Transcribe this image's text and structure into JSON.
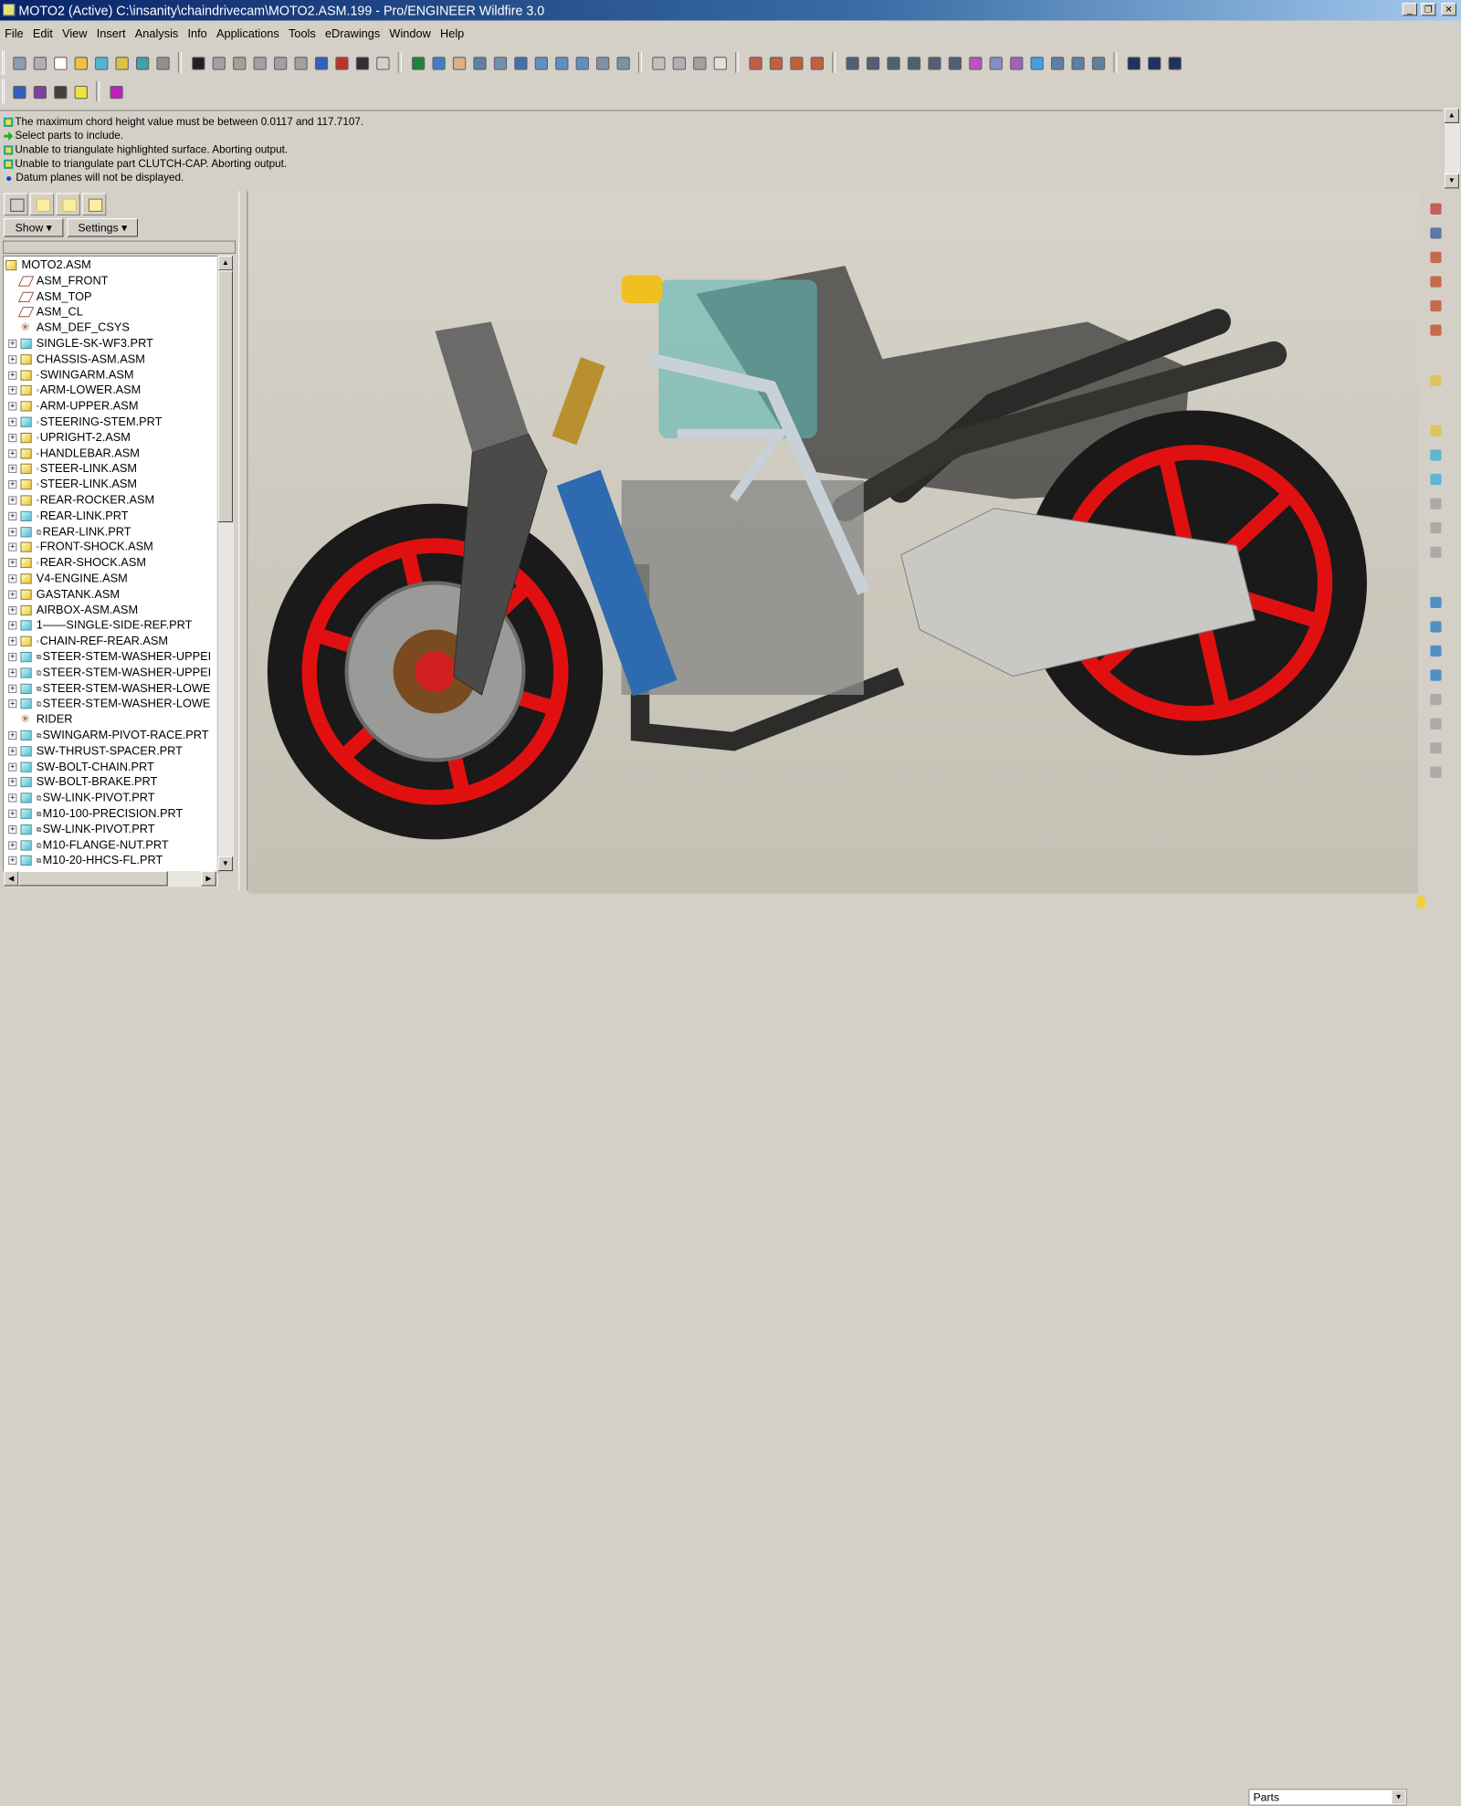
{
  "window": {
    "title": "MOTO2 (Active) C:\\insanity\\chaindrivecam\\MOTO2.ASM.199 - Pro/ENGINEER Wildfire 3.0",
    "controls": [
      "_",
      "❐",
      "✕"
    ]
  },
  "menu": [
    "File",
    "Edit",
    "View",
    "Insert",
    "Analysis",
    "Info",
    "Applications",
    "Tools",
    "eDrawings",
    "Window",
    "Help"
  ],
  "toolbar1": [
    {
      "icon": "new-session-icon",
      "color": "#8aa0b0"
    },
    {
      "icon": "erase-icon",
      "color": "#b0b0b0"
    },
    {
      "icon": "new-file-icon",
      "color": "#ffffff"
    },
    {
      "icon": "open-folder-icon",
      "color": "#f0c040"
    },
    {
      "icon": "save-icon",
      "color": "#50b8d0"
    },
    {
      "icon": "save-copy-icon",
      "color": "#e0c040"
    },
    {
      "icon": "backup-icon",
      "color": "#40a0b0"
    },
    {
      "icon": "print-icon",
      "color": "#909090"
    },
    {
      "sep": true
    },
    {
      "icon": "undo-icon",
      "color": "#202020"
    },
    {
      "icon": "redo-icon",
      "color": "#a0a0a0"
    },
    {
      "icon": "cut-icon",
      "color": "#a0a0a0"
    },
    {
      "icon": "copy-icon",
      "color": "#a0a0a0"
    },
    {
      "icon": "paste-icon",
      "color": "#a0a0a0"
    },
    {
      "icon": "paste-special-icon",
      "color": "#a0a0a0"
    },
    {
      "icon": "regenerate-icon",
      "color": "#3060c0"
    },
    {
      "icon": "regen-manager-icon",
      "color": "#c03030"
    },
    {
      "icon": "find-icon",
      "color": "#303030"
    },
    {
      "icon": "selection-box-icon",
      "color": "#d0d0d0"
    },
    {
      "sep": true
    },
    {
      "icon": "spin-center-icon",
      "color": "#208040"
    },
    {
      "icon": "orient-mode-icon",
      "color": "#4080c0"
    },
    {
      "icon": "pan-icon",
      "color": "#e0b080"
    },
    {
      "icon": "layers-icon",
      "color": "#6080a0"
    },
    {
      "icon": "view-manager-icon",
      "color": "#7090b0"
    },
    {
      "icon": "repaint-icon",
      "color": "#4070b0"
    },
    {
      "icon": "zoom-in-icon",
      "color": "#6090c0"
    },
    {
      "icon": "zoom-out-icon",
      "color": "#6090c0"
    },
    {
      "icon": "refit-icon",
      "color": "#6090c0"
    },
    {
      "icon": "reorient-icon",
      "color": "#8090a0"
    },
    {
      "icon": "saved-views-icon",
      "color": "#8090a0"
    },
    {
      "sep": true
    },
    {
      "icon": "wireframe-icon",
      "color": "#c0c0c0"
    },
    {
      "icon": "hidden-line-icon",
      "color": "#b0b0b0"
    },
    {
      "icon": "no-hidden-icon",
      "color": "#a0a0a0"
    },
    {
      "icon": "shading-icon",
      "color": "#e0e0e0"
    },
    {
      "sep": true
    },
    {
      "icon": "datum-planes-icon",
      "color": "#c06040"
    },
    {
      "icon": "datum-axes-icon",
      "color": "#c06040"
    },
    {
      "icon": "datum-points-icon",
      "color": "#c06040"
    },
    {
      "icon": "coordinate-systems-icon",
      "color": "#c06040"
    },
    {
      "sep": true
    },
    {
      "icon": "measure-icon",
      "color": "#506070"
    },
    {
      "icon": "mass-props-icon",
      "color": "#506070"
    },
    {
      "icon": "section-icon",
      "color": "#506070"
    },
    {
      "icon": "table-icon",
      "color": "#506070"
    },
    {
      "icon": "global-interference-icon",
      "color": "#506070"
    },
    {
      "icon": "pairs-clearance-icon",
      "color": "#506070"
    },
    {
      "icon": "curvature-icon",
      "color": "#c050c0"
    },
    {
      "icon": "draft-icon",
      "color": "#8090c0"
    },
    {
      "icon": "reflection-icon",
      "color": "#a060c0"
    },
    {
      "icon": "shaded-curvature-icon",
      "color": "#40a0e0"
    },
    {
      "icon": "dihedral-icon",
      "color": "#6080a0"
    },
    {
      "icon": "offset-icon",
      "color": "#6080a0"
    },
    {
      "icon": "deviation-icon",
      "color": "#6080a0"
    },
    {
      "sep": true
    },
    {
      "icon": "close-window-icon",
      "color": "#203060"
    },
    {
      "icon": "activate-window-icon",
      "color": "#203060"
    },
    {
      "icon": "close-icon",
      "color": "#203060"
    }
  ],
  "toolbar2": [
    {
      "icon": "model-display-icon",
      "color": "#3060c0"
    },
    {
      "icon": "dimension-display-icon",
      "color": "#8040a0"
    },
    {
      "icon": "component-display-icon",
      "color": "#404040"
    },
    {
      "icon": "component-placement-icon",
      "color": "#f0e040"
    },
    {
      "sep": true
    },
    {
      "icon": "context-help-icon",
      "color": "#c020c0"
    }
  ],
  "messages": [
    {
      "icon": "info",
      "text": "The maximum chord height value must be between 0.0117 and 117.7107."
    },
    {
      "icon": "prompt",
      "text": "Select parts to include."
    },
    {
      "icon": "info",
      "text": "Unable to triangulate highlighted surface. Aborting output."
    },
    {
      "icon": "info",
      "text": "Unable to triangulate part CLUTCH-CAP.  Aborting output."
    },
    {
      "icon": "bullet",
      "text": "Datum planes will not be displayed."
    }
  ],
  "navigator": {
    "tabs": [
      "model-tree-tab",
      "folder-browser-tab",
      "favorites-tab",
      "connections-tab"
    ],
    "show_label": "Show ▾",
    "settings_label": "Settings ▾",
    "tree": [
      {
        "label": "MOTO2.ASM",
        "type": "asm",
        "root": true
      },
      {
        "label": "ASM_FRONT",
        "type": "plane"
      },
      {
        "label": "ASM_TOP",
        "type": "plane"
      },
      {
        "label": "ASM_CL",
        "type": "plane"
      },
      {
        "label": "ASM_DEF_CSYS",
        "type": "csys"
      },
      {
        "label": "SINGLE-SK-WF3.PRT",
        "type": "part",
        "exp": true
      },
      {
        "label": "CHASSIS-ASM.ASM",
        "type": "asm",
        "exp": true
      },
      {
        "label": "SWINGARM.ASM",
        "type": "asm",
        "exp": true,
        "mark": "▫"
      },
      {
        "label": "ARM-LOWER.ASM",
        "type": "asm",
        "exp": true,
        "mark": "▫"
      },
      {
        "label": "ARM-UPPER.ASM",
        "type": "asm",
        "exp": true,
        "mark": "▫"
      },
      {
        "label": "STEERING-STEM.PRT",
        "type": "part",
        "exp": true,
        "mark": "▫"
      },
      {
        "label": "UPRIGHT-2.ASM",
        "type": "asm",
        "exp": true,
        "mark": "▫"
      },
      {
        "label": "HANDLEBAR.ASM",
        "type": "asm",
        "exp": true,
        "mark": "▫"
      },
      {
        "label": "STEER-LINK.ASM",
        "type": "asm",
        "exp": true,
        "mark": "▫"
      },
      {
        "label": "STEER-LINK.ASM",
        "type": "asm",
        "exp": true,
        "mark": "▫"
      },
      {
        "label": "REAR-ROCKER.ASM",
        "type": "asm",
        "exp": true,
        "mark": "▫"
      },
      {
        "label": "REAR-LINK.PRT",
        "type": "part",
        "exp": true,
        "mark": "▫"
      },
      {
        "label": "REAR-LINK.PRT",
        "type": "part",
        "exp": true,
        "mark": "⧉"
      },
      {
        "label": "FRONT-SHOCK.ASM",
        "type": "asm",
        "exp": true,
        "mark": "▫"
      },
      {
        "label": "REAR-SHOCK.ASM",
        "type": "asm",
        "exp": true,
        "mark": "▫"
      },
      {
        "label": "V4-ENGINE.ASM",
        "type": "asm",
        "exp": true
      },
      {
        "label": "GASTANK.ASM",
        "type": "asm",
        "exp": true
      },
      {
        "label": "AIRBOX-ASM.ASM",
        "type": "asm",
        "exp": true
      },
      {
        "label": "1——SINGLE-SIDE-REF.PRT",
        "type": "part",
        "exp": true
      },
      {
        "label": "CHAIN-REF-REAR.ASM",
        "type": "asm",
        "exp": true,
        "mark": "▫"
      },
      {
        "label": "STEER-STEM-WASHER-UPPEI",
        "type": "part",
        "exp": true,
        "mark": "⧉"
      },
      {
        "label": "STEER-STEM-WASHER-UPPEI",
        "type": "part",
        "exp": true,
        "mark": "⧉"
      },
      {
        "label": "STEER-STEM-WASHER-LOWE",
        "type": "part",
        "exp": true,
        "mark": "⧉"
      },
      {
        "label": "STEER-STEM-WASHER-LOWE",
        "type": "part",
        "exp": true,
        "mark": "⧉"
      },
      {
        "label": "RIDER",
        "type": "csys"
      },
      {
        "label": "SWINGARM-PIVOT-RACE.PRT",
        "type": "part",
        "exp": true,
        "mark": "⧉"
      },
      {
        "label": "SW-THRUST-SPACER.PRT",
        "type": "part",
        "exp": true
      },
      {
        "label": "SW-BOLT-CHAIN.PRT",
        "type": "part",
        "exp": true
      },
      {
        "label": "SW-BOLT-BRAKE.PRT",
        "type": "part",
        "exp": true
      },
      {
        "label": "SW-LINK-PIVOT.PRT",
        "type": "part",
        "exp": true,
        "mark": "⧉"
      },
      {
        "label": "M10-100-PRECISION.PRT",
        "type": "part",
        "exp": true,
        "mark": "⧉"
      },
      {
        "label": "SW-LINK-PIVOT.PRT",
        "type": "part",
        "exp": true,
        "mark": "⧉"
      },
      {
        "label": "M10-FLANGE-NUT.PRT",
        "type": "part",
        "exp": true,
        "mark": "⧉"
      },
      {
        "label": "M10-20-HHCS-FL.PRT",
        "type": "part",
        "exp": true,
        "mark": "⧉"
      }
    ]
  },
  "right_toolbar": [
    {
      "icon": "datum-point-tool-icon",
      "color": "#c04040"
    },
    {
      "icon": "datum-curve-sketch-icon",
      "color": "#4060a0"
    },
    {
      "icon": "datum-plane-tool-icon",
      "color": "#c05030"
    },
    {
      "icon": "datum-axis-tool-icon",
      "color": "#c05030"
    },
    {
      "icon": "datum-curve-tool-icon",
      "color": "#c05030"
    },
    {
      "icon": "csys-tool-icon",
      "color": "#c05030"
    },
    {
      "icon": "annotation-icon",
      "color": "#e0c040"
    },
    {
      "icon": "assemble-icon",
      "color": "#e0c040"
    },
    {
      "icon": "create-component-icon",
      "color": "#40b0d0"
    },
    {
      "icon": "extrude-icon",
      "color": "#40b0d0"
    },
    {
      "icon": "revolve-icon",
      "color": "#a0a0a0"
    },
    {
      "icon": "hole-icon",
      "color": "#a0a0a0"
    },
    {
      "icon": "round-icon",
      "color": "#a0a0a0"
    },
    {
      "icon": "pattern-icon",
      "color": "#3080c0"
    },
    {
      "icon": "mirror-icon",
      "color": "#3080c0"
    },
    {
      "icon": "merge-icon",
      "color": "#3080c0"
    },
    {
      "icon": "trim-icon",
      "color": "#3080c0"
    },
    {
      "icon": "offset-tool-icon",
      "color": "#a0a0a0"
    },
    {
      "icon": "thicken-icon",
      "color": "#a0a0a0"
    },
    {
      "icon": "solidify-icon",
      "color": "#a0a0a0"
    },
    {
      "icon": "table-tool-icon",
      "color": "#a0a0a0"
    }
  ],
  "status": {
    "filter_value": "Parts"
  }
}
